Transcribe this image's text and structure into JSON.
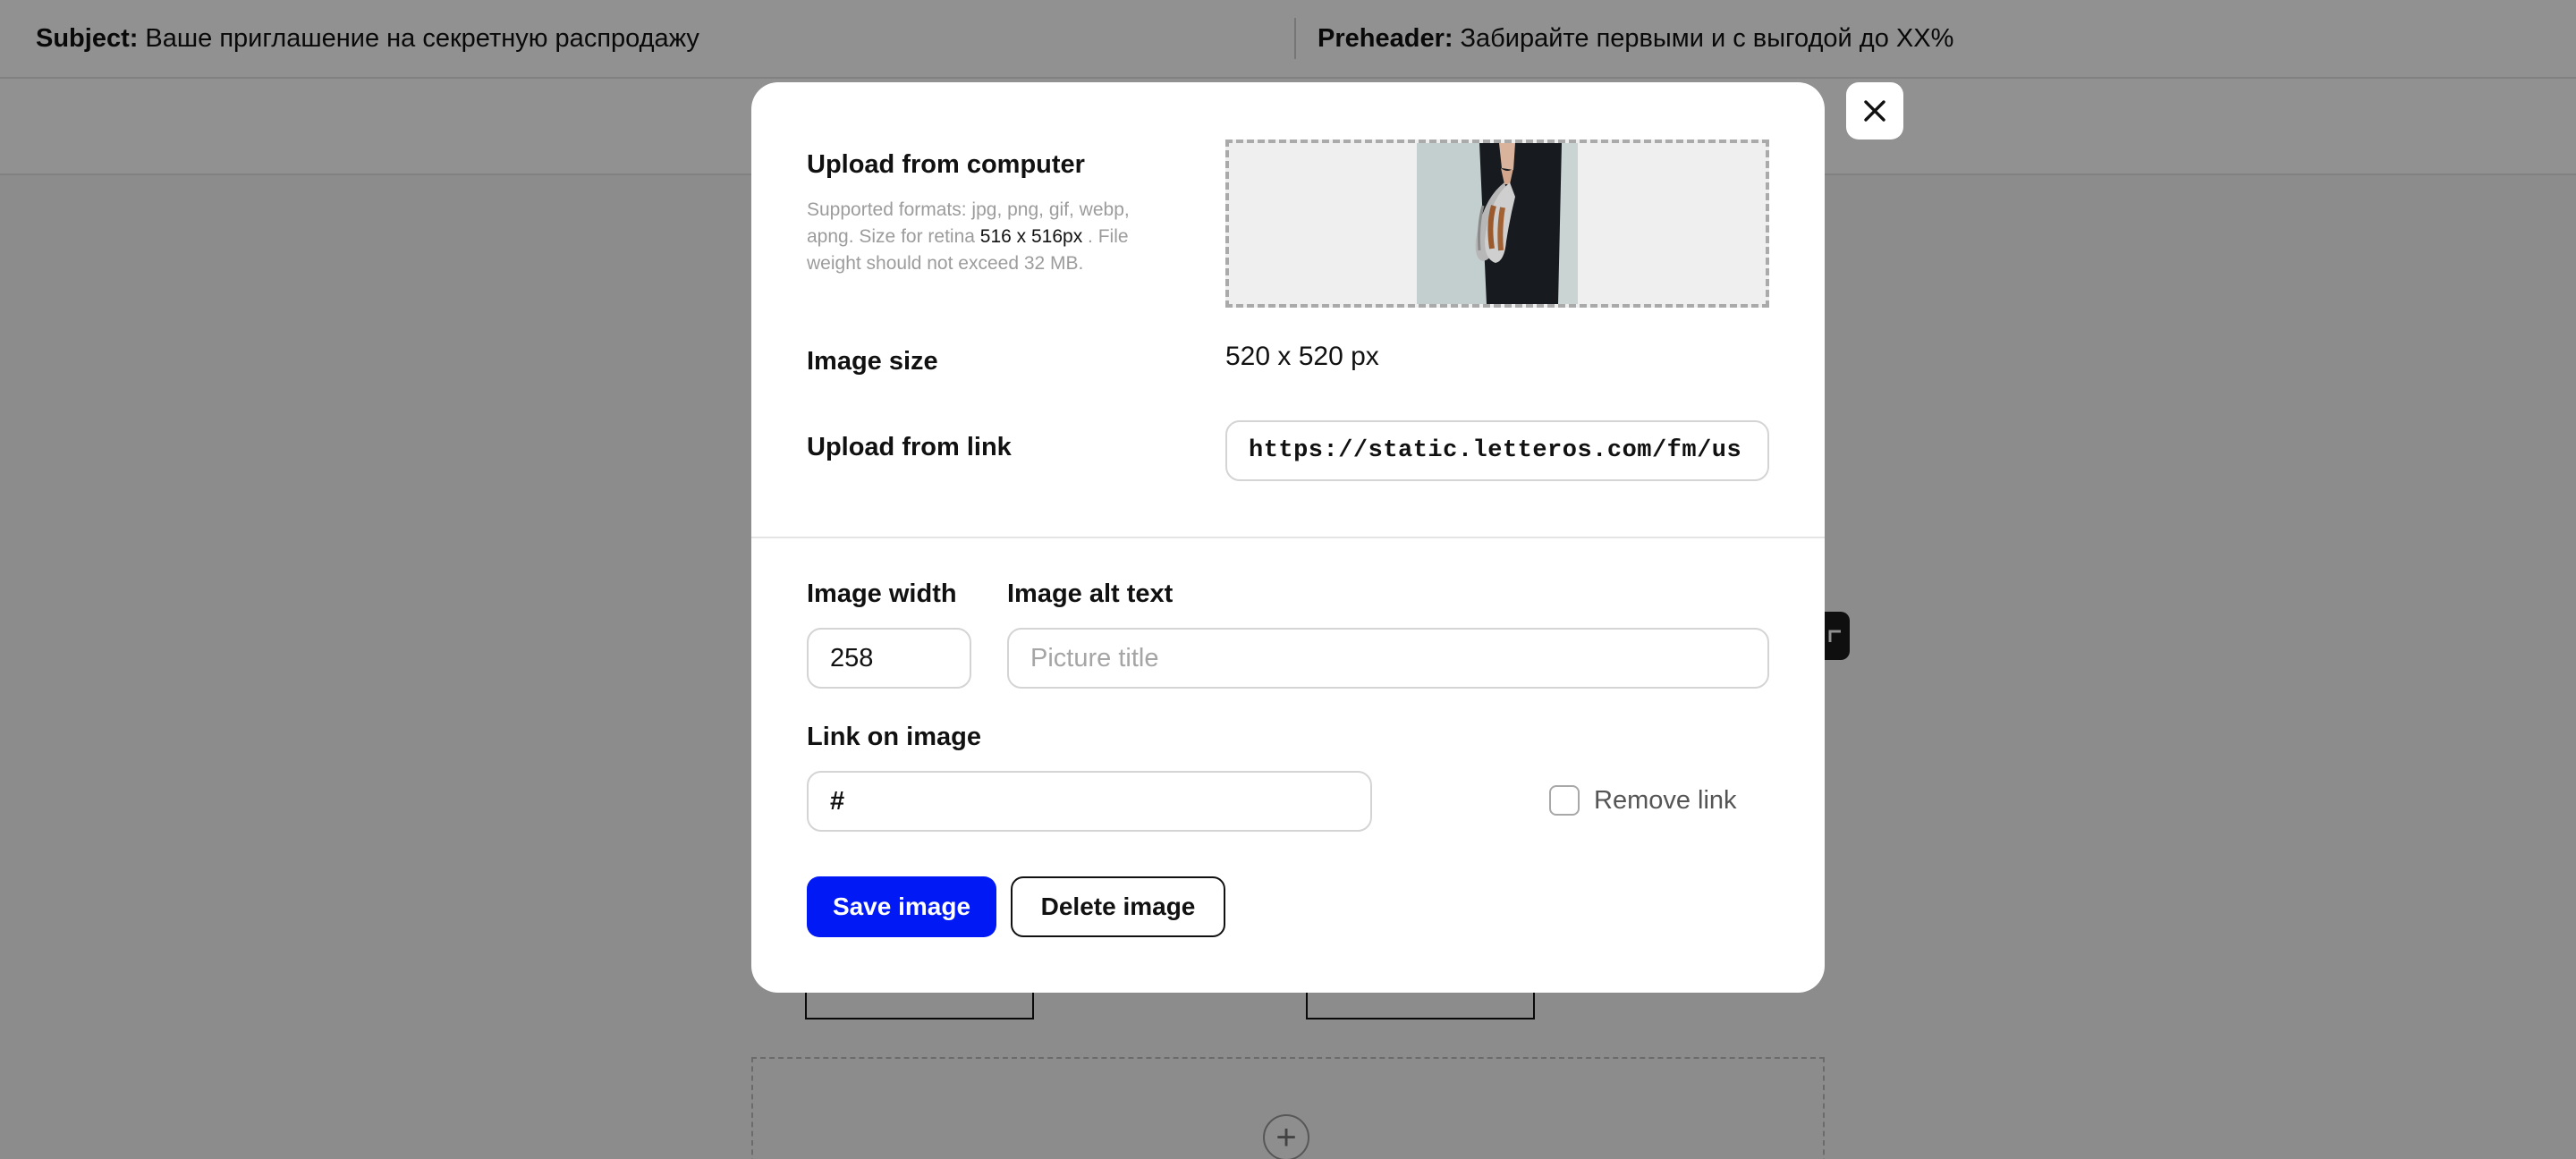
{
  "header": {
    "subject_label": "Subject:",
    "subject_value": "Ваше приглашение на секретную распродажу",
    "preheader_label": "Preheader:",
    "preheader_value": "Забирайте первыми и с выгодой до XX%"
  },
  "modal": {
    "upload_computer_label": "Upload from computer",
    "hint_part1": "Supported formats: jpg, png, gif, webp, apng. Size for retina ",
    "hint_size": "516 x 516px",
    "hint_part2": " . File weight should not exceed 32 MB.",
    "image_size_label": "Image size",
    "image_size_value": "520 x 520 px",
    "upload_link_label": "Upload from link",
    "upload_link_value": "https://static.letteros.com/fm/us",
    "image_width_label": "Image width",
    "image_width_value": "258",
    "alt_text_label": "Image alt text",
    "alt_text_placeholder": "Picture title",
    "link_label": "Link on image",
    "link_value": "#",
    "remove_link_label": "Remove link",
    "remove_link_checked": false,
    "save_button": "Save image",
    "delete_button": "Delete image"
  },
  "icons": {
    "close": "close-icon",
    "add": "plus-icon"
  },
  "colors": {
    "primary": "#0019f5",
    "overlay": "rgba(0,0,0,0.43)"
  }
}
